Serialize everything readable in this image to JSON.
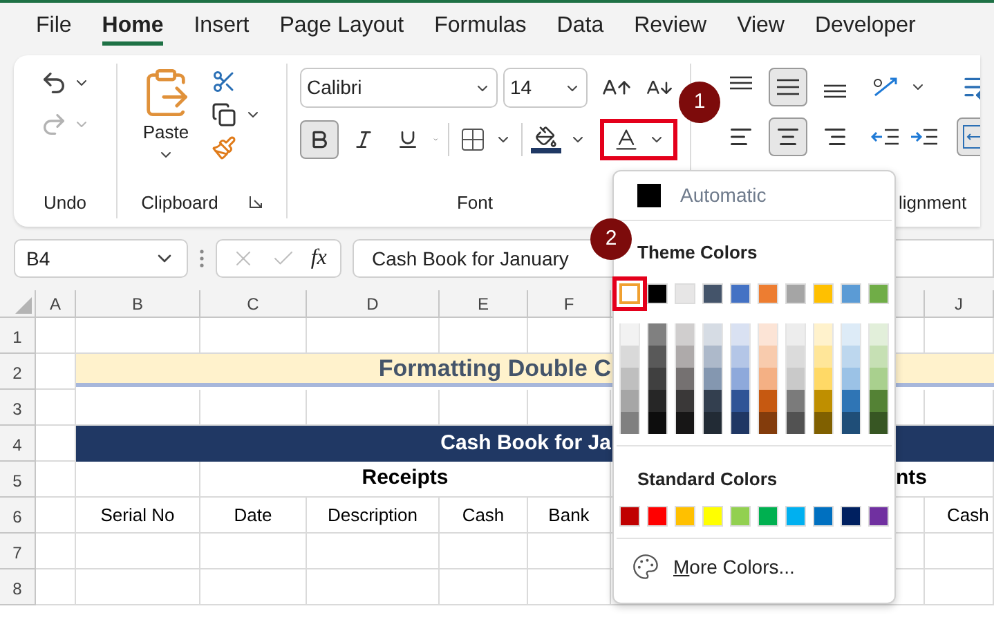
{
  "tabs": [
    {
      "label": "File",
      "selected": false
    },
    {
      "label": "Home",
      "selected": true
    },
    {
      "label": "Insert",
      "selected": false
    },
    {
      "label": "Page Layout",
      "selected": false
    },
    {
      "label": "Formulas",
      "selected": false
    },
    {
      "label": "Data",
      "selected": false
    },
    {
      "label": "Review",
      "selected": false
    },
    {
      "label": "View",
      "selected": false
    },
    {
      "label": "Developer",
      "selected": false
    }
  ],
  "ribbon": {
    "undo_group": {
      "label": "Undo",
      "redo_disabled": true
    },
    "clipboard_group": {
      "label": "Clipboard",
      "paste_label": "Paste"
    },
    "font_group": {
      "label": "Font",
      "font_name": "Calibri",
      "font_size": "14",
      "bold": true,
      "italic": false,
      "underline": false,
      "font_color_highlighted": true
    },
    "alignment_group": {
      "label": "lignment",
      "top_align": false,
      "middle_align": true,
      "bottom_align": false,
      "left_align": false,
      "center_align": true,
      "right_align": false,
      "merge": true
    }
  },
  "callouts": [
    {
      "label": "1"
    },
    {
      "label": "2"
    }
  ],
  "formula_bar": {
    "name_box": "B4",
    "function_label": "fx",
    "value": "Cash Book for January"
  },
  "sheet": {
    "columns": [
      "A",
      "B",
      "C",
      "D",
      "E",
      "F",
      "J"
    ],
    "rows": [
      "1",
      "2",
      "3",
      "4",
      "5",
      "6",
      "7",
      "8"
    ],
    "title": "Formatting Double C",
    "banner": "Cash Book for Ja",
    "receipts_heading": "Receipts",
    "payments_heading": "nts",
    "headers": [
      "Serial No",
      "Date",
      "Description",
      "Cash",
      "Bank"
    ],
    "header_right": "Cash"
  },
  "font_color_menu": {
    "automatic": "Automatic",
    "theme_heading": "Theme Colors",
    "standard_heading": "Standard Colors",
    "more_colors": "More Colors...",
    "theme_colors": [
      {
        "color": "#ffffff",
        "selected": true,
        "shades": [
          {
            "color": "#f2f2f2"
          },
          {
            "color": "#d9d9d9"
          },
          {
            "color": "#bfbfbf"
          },
          {
            "color": "#a6a6a6"
          },
          {
            "color": "#808080"
          }
        ]
      },
      {
        "color": "#000000",
        "selected": false,
        "shades": [
          {
            "color": "#808080"
          },
          {
            "color": "#595959"
          },
          {
            "color": "#404040"
          },
          {
            "color": "#262626"
          },
          {
            "color": "#0d0d0d"
          }
        ]
      },
      {
        "color": "#e7e6e6",
        "selected": false,
        "shades": [
          {
            "color": "#d0cece"
          },
          {
            "color": "#aeaaaa"
          },
          {
            "color": "#757171"
          },
          {
            "color": "#3a3838"
          },
          {
            "color": "#171616"
          }
        ]
      },
      {
        "color": "#44546a",
        "selected": false,
        "shades": [
          {
            "color": "#d6dce4"
          },
          {
            "color": "#adb9ca"
          },
          {
            "color": "#8497b0"
          },
          {
            "color": "#333f4f"
          },
          {
            "color": "#222b35"
          }
        ]
      },
      {
        "color": "#4472c4",
        "selected": false,
        "shades": [
          {
            "color": "#d9e1f2"
          },
          {
            "color": "#b4c6e7"
          },
          {
            "color": "#8ea9db"
          },
          {
            "color": "#305496"
          },
          {
            "color": "#203764"
          }
        ]
      },
      {
        "color": "#ed7d31",
        "selected": false,
        "shades": [
          {
            "color": "#fce4d6"
          },
          {
            "color": "#f8cbad"
          },
          {
            "color": "#f4b084"
          },
          {
            "color": "#c65911"
          },
          {
            "color": "#833c0c"
          }
        ]
      },
      {
        "color": "#a5a5a5",
        "selected": false,
        "shades": [
          {
            "color": "#ededed"
          },
          {
            "color": "#dbdbdb"
          },
          {
            "color": "#c9c9c9"
          },
          {
            "color": "#7b7b7b"
          },
          {
            "color": "#525252"
          }
        ]
      },
      {
        "color": "#ffc000",
        "selected": false,
        "shades": [
          {
            "color": "#fff2cc"
          },
          {
            "color": "#ffe699"
          },
          {
            "color": "#ffd966"
          },
          {
            "color": "#bf8f00"
          },
          {
            "color": "#806000"
          }
        ]
      },
      {
        "color": "#5b9bd5",
        "selected": false,
        "shades": [
          {
            "color": "#ddebf7"
          },
          {
            "color": "#bdd7ee"
          },
          {
            "color": "#9bc2e6"
          },
          {
            "color": "#2f75b5"
          },
          {
            "color": "#1f4e78"
          }
        ]
      },
      {
        "color": "#70ad47",
        "selected": false,
        "shades": [
          {
            "color": "#e2efda"
          },
          {
            "color": "#c6e0b4"
          },
          {
            "color": "#a9d08e"
          },
          {
            "color": "#548235"
          },
          {
            "color": "#375623"
          }
        ]
      }
    ],
    "standard_colors": [
      {
        "color": "#c00000"
      },
      {
        "color": "#ff0000"
      },
      {
        "color": "#ffc000"
      },
      {
        "color": "#ffff00"
      },
      {
        "color": "#92d050"
      },
      {
        "color": "#00b050"
      },
      {
        "color": "#00b0f0"
      },
      {
        "color": "#0070c0"
      },
      {
        "color": "#002060"
      },
      {
        "color": "#7030a0"
      }
    ]
  }
}
